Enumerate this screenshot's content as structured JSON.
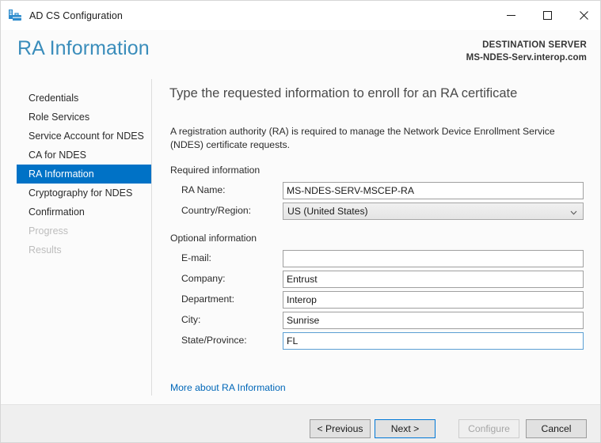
{
  "window": {
    "title": "AD CS Configuration",
    "icon": "server-toolbox-icon",
    "controls": {
      "minimize": "minimize-icon",
      "maximize": "maximize-icon",
      "close": "close-icon"
    }
  },
  "header": {
    "page_title": "RA Information",
    "destination_label": "DESTINATION SERVER",
    "destination_server": "MS-NDES-Serv.interop.com",
    "accent_color": "#3a8dbb"
  },
  "sidebar": {
    "selected_color": "#0072c6",
    "items": [
      {
        "label": "Credentials",
        "state": "enabled"
      },
      {
        "label": "Role Services",
        "state": "enabled"
      },
      {
        "label": "Service Account for NDES",
        "state": "enabled"
      },
      {
        "label": "CA for NDES",
        "state": "enabled"
      },
      {
        "label": "RA Information",
        "state": "selected"
      },
      {
        "label": "Cryptography for NDES",
        "state": "enabled"
      },
      {
        "label": "Confirmation",
        "state": "enabled"
      },
      {
        "label": "Progress",
        "state": "disabled"
      },
      {
        "label": "Results",
        "state": "disabled"
      }
    ]
  },
  "main": {
    "heading": "Type the requested information to enroll for an RA certificate",
    "description": "A registration authority (RA) is required to manage the Network Device Enrollment Service (NDES) certificate requests.",
    "required_section_label": "Required information",
    "optional_section_label": "Optional information",
    "fields": {
      "ra_name": {
        "label": "RA Name:",
        "value": "MS-NDES-SERV-MSCEP-RA",
        "placeholder": "",
        "type": "text"
      },
      "country_region": {
        "label": "Country/Region:",
        "value": "US (United States)",
        "type": "combobox",
        "chevron": "chevron-down-icon"
      },
      "email": {
        "label": "E-mail:",
        "value": "",
        "placeholder": "",
        "type": "text"
      },
      "company": {
        "label": "Company:",
        "value": "Entrust",
        "placeholder": "",
        "type": "text"
      },
      "department": {
        "label": "Department:",
        "value": "Interop",
        "placeholder": "",
        "type": "text"
      },
      "city": {
        "label": "City:",
        "value": "Sunrise",
        "placeholder": "",
        "type": "text"
      },
      "state_province": {
        "label": "State/Province:",
        "value": "FL",
        "placeholder": "",
        "type": "text",
        "focused": true
      }
    },
    "help_link": "More about RA Information",
    "link_color": "#0067b8"
  },
  "footer": {
    "buttons": [
      {
        "label": "< Previous",
        "state": "enabled"
      },
      {
        "label": "Next >",
        "state": "focused"
      },
      {
        "label": "Configure",
        "state": "disabled"
      },
      {
        "label": "Cancel",
        "state": "enabled"
      }
    ]
  }
}
